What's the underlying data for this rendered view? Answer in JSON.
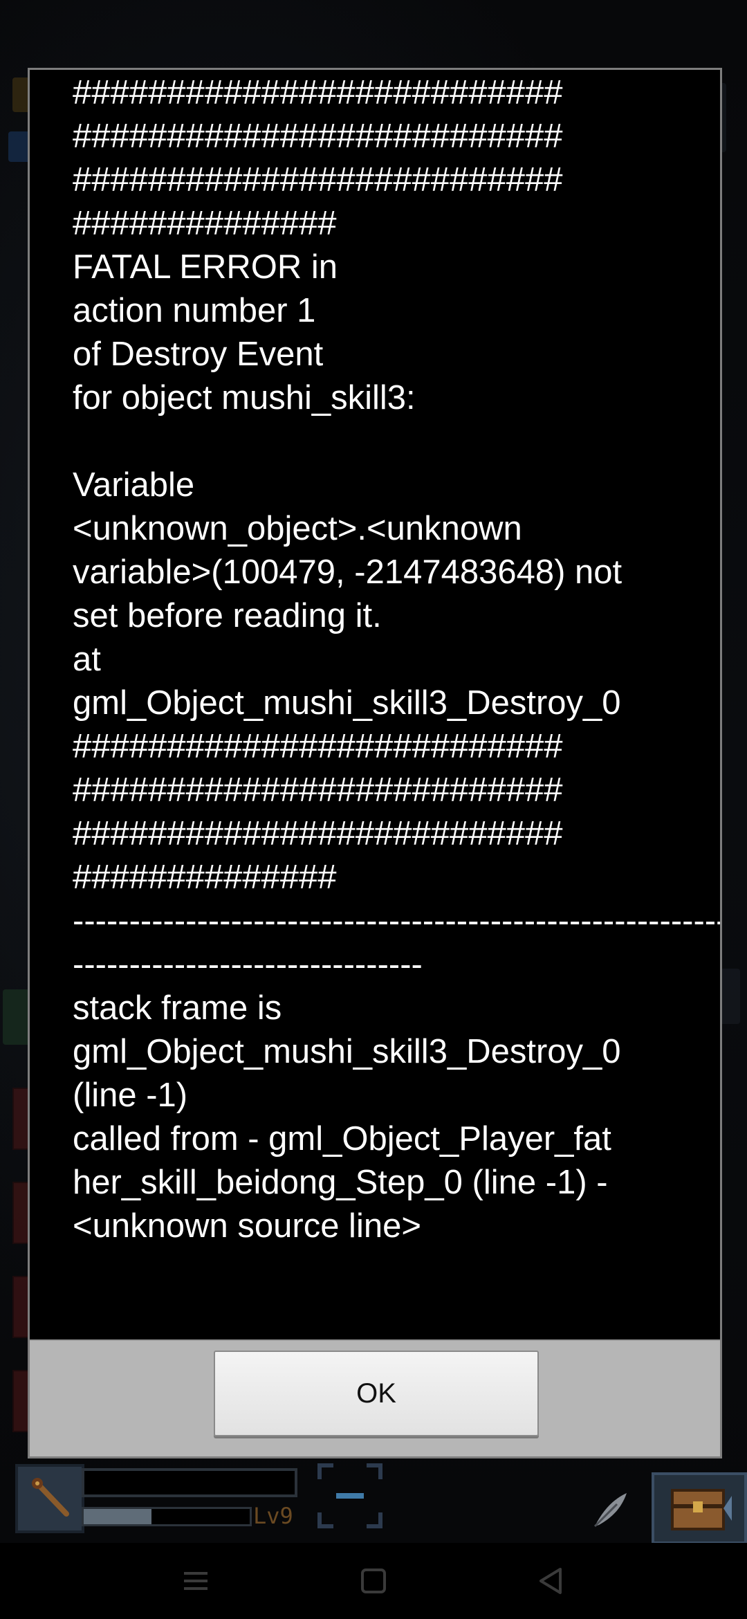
{
  "dialog": {
    "message": "##########################\n##########################\n##########################\n##############\nFATAL ERROR in\naction number 1\nof Destroy Event\nfor object mushi_skill3:\n\nVariable\n<unknown_object>.<unknown\nvariable>(100479, -2147483648) not\nset before reading it.\nat\ngml_Object_mushi_skill3_Destroy_0\n##########################\n##########################\n##########################\n##############\n------------------------------------------------------------\n-------------------------------\nstack frame is\ngml_Object_mushi_skill3_Destroy_0\n(line -1)\ncalled from - gml_Object_Player_fat\nher_skill_beidong_Step_0 (line -1) -\n<unknown source line>",
    "ok_label": "OK"
  },
  "hud": {
    "level_label": "Lv9",
    "xp_progress": 0.41,
    "weapon_icon": "staff-icon",
    "skill_icon": "feather-icon",
    "chest_icon": "treasure-chest-icon"
  },
  "nav": {
    "menu_icon": "menu-icon",
    "home_icon": "home-square-icon",
    "back_icon": "back-triangle-icon"
  },
  "colors": {
    "dialog_bg": "#000000",
    "dialog_footer": "#b6b6b6",
    "button_bg": "#eeeeee",
    "text": "#ffffff"
  }
}
